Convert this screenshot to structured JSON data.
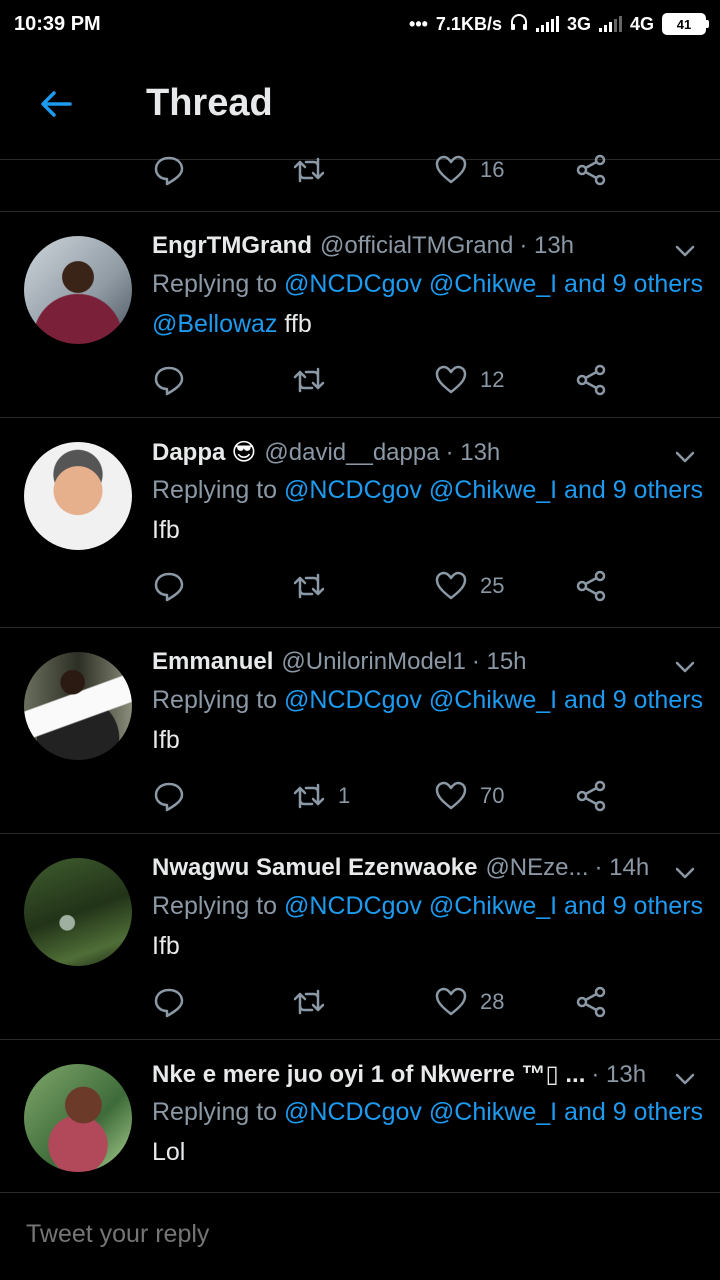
{
  "status_bar": {
    "time": "10:39 PM",
    "dots": "•••",
    "speed": "7.1KB/s",
    "net1": "3G",
    "net2": "4G",
    "battery": "41"
  },
  "header": {
    "title": "Thread"
  },
  "top_actions": {
    "likes": "16"
  },
  "tweets": [
    {
      "name": "EngrTMGrand",
      "emoji": "",
      "handle": "@officialTMGrand",
      "time": "· 13h",
      "replying_prefix": "Replying to",
      "mention1": "@NCDCgov",
      "mention2": "@Chikwe_I",
      "and_others": "and 9 others",
      "text_mention": "@Bellowaz",
      "text": " ffb",
      "retweets": "",
      "likes": "12"
    },
    {
      "name": "Dappa",
      "emoji": "😎",
      "handle": "@david__dappa",
      "time": "· 13h",
      "replying_prefix": "Replying to",
      "mention1": "@NCDCgov",
      "mention2": "@Chikwe_I",
      "and_others": "and 9 others",
      "text_mention": "",
      "text": "Ifb",
      "retweets": "",
      "likes": "25"
    },
    {
      "name": "Emmanuel",
      "emoji": "",
      "handle": "@UnilorinModel1",
      "time": "· 15h",
      "replying_prefix": "Replying to",
      "mention1": "@NCDCgov",
      "mention2": "@Chikwe_I",
      "and_others": "and 9 others",
      "text_mention": "",
      "text": "Ifb",
      "retweets": "1",
      "likes": "70"
    },
    {
      "name": "Nwagwu Samuel Ezenwaoke",
      "emoji": "",
      "handle": "@NEze...",
      "time": "· 14h",
      "replying_prefix": "Replying to",
      "mention1": "@NCDCgov",
      "mention2": "@Chikwe_I",
      "and_others": "and 9 others",
      "text_mention": "",
      "text": "Ifb",
      "retweets": "",
      "likes": "28"
    },
    {
      "name": "Nke e mere juo oyi 1 of Nkwerre ™▯ ...",
      "emoji": "",
      "handle": "",
      "time": "· 13h",
      "replying_prefix": "Replying to",
      "mention1": "@NCDCgov",
      "mention2": "@Chikwe_I",
      "and_others": "and 9 others",
      "text_mention": "",
      "text": "Lol",
      "retweets": "",
      "likes": ""
    }
  ],
  "reply_bar": {
    "placeholder": "Tweet your reply"
  },
  "colors": {
    "accent": "#1d9bf0",
    "muted": "#8b98a5",
    "background": "#000000"
  }
}
